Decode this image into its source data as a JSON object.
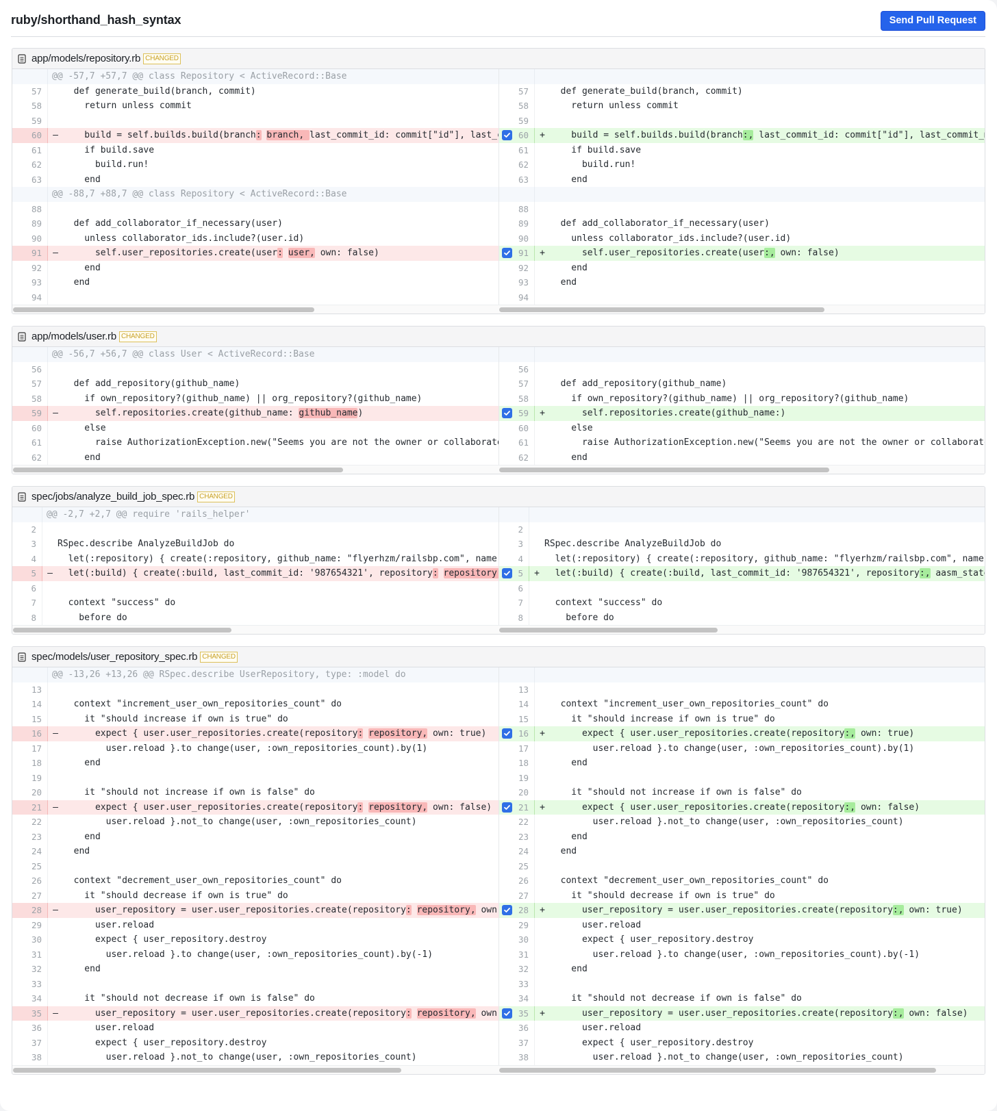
{
  "header": {
    "title": "ruby/shorthand_hash_syntax",
    "send_button_label": "Send Pull Request",
    "accent_color": "#2563eb"
  },
  "badge_label": "CHANGED",
  "files": [
    {
      "path": "app/models/repository.rb",
      "status": "CHANGED",
      "narrow": false,
      "scroll": {
        "left_visible_fraction": 0.62,
        "right_visible_fraction": 0.67
      },
      "rows": [
        {
          "type": "hunk",
          "text": "@@ -57,7 +57,7 @@ class Repository < ActiveRecord::Base"
        },
        {
          "type": "ctx",
          "ln": 57,
          "rn": 57,
          "left": "  def generate_build(branch, commit)",
          "right": "  def generate_build(branch, commit)"
        },
        {
          "type": "ctx",
          "ln": 58,
          "rn": 58,
          "left": "    return unless commit",
          "right": "    return unless commit"
        },
        {
          "type": "ctx",
          "ln": 59,
          "rn": 59,
          "left": "",
          "right": ""
        },
        {
          "type": "change",
          "ln": 60,
          "rn": 60,
          "checked": true,
          "left": [
            [
              "    build = self.builds.build(branch",
              ""
            ],
            [
              ":",
              "del"
            ],
            [
              " ",
              ""
            ],
            [
              "branch, ",
              "del"
            ],
            [
              "last_commit_id: commit[\"id\"], last_commit_message: commit[\"message\"])",
              ""
            ]
          ],
          "right": [
            [
              "    build = self.builds.build(branch",
              ""
            ],
            [
              ":,",
              "add"
            ],
            [
              " last_commit_id: commit[\"id\"], last_commit_message: commit[\"message\"])",
              ""
            ]
          ]
        },
        {
          "type": "ctx",
          "ln": 61,
          "rn": 61,
          "left": "    if build.save",
          "right": "    if build.save"
        },
        {
          "type": "ctx",
          "ln": 62,
          "rn": 62,
          "left": "      build.run!",
          "right": "      build.run!"
        },
        {
          "type": "ctx",
          "ln": 63,
          "rn": 63,
          "left": "    end",
          "right": "    end"
        },
        {
          "type": "hunk",
          "text": "@@ -88,7 +88,7 @@ class Repository < ActiveRecord::Base"
        },
        {
          "type": "ctx",
          "ln": 88,
          "rn": 88,
          "left": "",
          "right": ""
        },
        {
          "type": "ctx",
          "ln": 89,
          "rn": 89,
          "left": "  def add_collaborator_if_necessary(user)",
          "right": "  def add_collaborator_if_necessary(user)"
        },
        {
          "type": "ctx",
          "ln": 90,
          "rn": 90,
          "left": "    unless collaborator_ids.include?(user.id)",
          "right": "    unless collaborator_ids.include?(user.id)"
        },
        {
          "type": "change",
          "ln": 91,
          "rn": 91,
          "checked": true,
          "left": [
            [
              "      self.user_repositories.create(user",
              ""
            ],
            [
              ":",
              "del"
            ],
            [
              " ",
              ""
            ],
            [
              "user,",
              "del"
            ],
            [
              " own: false)",
              ""
            ]
          ],
          "right": [
            [
              "      self.user_repositories.create(user",
              ""
            ],
            [
              ":,",
              "add"
            ],
            [
              " own: false)",
              ""
            ]
          ]
        },
        {
          "type": "ctx",
          "ln": 92,
          "rn": 92,
          "left": "    end",
          "right": "    end"
        },
        {
          "type": "ctx",
          "ln": 93,
          "rn": 93,
          "left": "  end",
          "right": "  end"
        },
        {
          "type": "ctx",
          "ln": 94,
          "rn": 94,
          "left": "",
          "right": ""
        }
      ]
    },
    {
      "path": "app/models/user.rb",
      "status": "CHANGED",
      "narrow": false,
      "scroll": {
        "left_visible_fraction": 0.68,
        "right_visible_fraction": 0.68
      },
      "rows": [
        {
          "type": "hunk",
          "text": "@@ -56,7 +56,7 @@ class User < ActiveRecord::Base"
        },
        {
          "type": "ctx",
          "ln": 56,
          "rn": 56,
          "left": "",
          "right": ""
        },
        {
          "type": "ctx",
          "ln": 57,
          "rn": 57,
          "left": "  def add_repository(github_name)",
          "right": "  def add_repository(github_name)"
        },
        {
          "type": "ctx",
          "ln": 58,
          "rn": 58,
          "left": "    if own_repository?(github_name) || org_repository?(github_name)",
          "right": "    if own_repository?(github_name) || org_repository?(github_name)"
        },
        {
          "type": "change",
          "ln": 59,
          "rn": 59,
          "checked": true,
          "left": [
            [
              "      self.repositories.create(github_name: ",
              ""
            ],
            [
              "github_name",
              "del"
            ],
            [
              ")",
              ""
            ]
          ],
          "right": [
            [
              "      self.repositories.create(github_name:)",
              ""
            ]
          ]
        },
        {
          "type": "ctx",
          "ln": 60,
          "rn": 60,
          "left": "    else",
          "right": "    else"
        },
        {
          "type": "ctx",
          "ln": 61,
          "rn": 61,
          "left": "      raise AuthorizationException.new(\"Seems you are not the owner or collaborator of this repository\")",
          "right": "      raise AuthorizationException.new(\"Seems you are not the owner or collaborator of this repository\")"
        },
        {
          "type": "ctx",
          "ln": 62,
          "rn": 62,
          "left": "    end",
          "right": "    end"
        }
      ]
    },
    {
      "path": "spec/jobs/analyze_build_job_spec.rb",
      "status": "CHANGED",
      "narrow": true,
      "scroll": {
        "left_visible_fraction": 0.45,
        "right_visible_fraction": 0.45
      },
      "rows": [
        {
          "type": "hunk",
          "text": "@@ -2,7 +2,7 @@ require 'rails_helper'"
        },
        {
          "type": "ctx",
          "ln": 2,
          "rn": 2,
          "left": "",
          "right": ""
        },
        {
          "type": "ctx",
          "ln": 3,
          "rn": 3,
          "left": "RSpec.describe AnalyzeBuildJob do",
          "right": "RSpec.describe AnalyzeBuildJob do"
        },
        {
          "type": "ctx",
          "ln": 4,
          "rn": 4,
          "left": "  let(:repository) { create(:repository, github_name: \"flyerhzm/railsbp.com\", name: \"railsbp.com\") }",
          "right": "  let(:repository) { create(:repository, github_name: \"flyerhzm/railsbp.com\", name: \"railsbp.com\") }"
        },
        {
          "type": "change",
          "ln": 5,
          "rn": 5,
          "checked": true,
          "left": [
            [
              "  let(:build) { create(:build, last_commit_id: '987654321', repository",
              ""
            ],
            [
              ":",
              "del"
            ],
            [
              " ",
              ""
            ],
            [
              "repository,",
              "del"
            ],
            [
              " aasm_state: 'running') }",
              ""
            ]
          ],
          "right": [
            [
              "  let(:build) { create(:build, last_commit_id: '987654321', repository",
              ""
            ],
            [
              ":,",
              "add"
            ],
            [
              " aasm_state: 'running') }",
              ""
            ]
          ]
        },
        {
          "type": "ctx",
          "ln": 6,
          "rn": 6,
          "left": "",
          "right": ""
        },
        {
          "type": "ctx",
          "ln": 7,
          "rn": 7,
          "left": "  context \"success\" do",
          "right": "  context \"success\" do"
        },
        {
          "type": "ctx",
          "ln": 8,
          "rn": 8,
          "left": "    before do",
          "right": "    before do"
        }
      ]
    },
    {
      "path": "spec/models/user_repository_spec.rb",
      "status": "CHANGED",
      "narrow": false,
      "scroll": {
        "left_visible_fraction": 0.8,
        "right_visible_fraction": 0.9
      },
      "rows": [
        {
          "type": "hunk",
          "text": "@@ -13,26 +13,26 @@ RSpec.describe UserRepository, type: :model do"
        },
        {
          "type": "ctx",
          "ln": 13,
          "rn": 13,
          "left": "",
          "right": ""
        },
        {
          "type": "ctx",
          "ln": 14,
          "rn": 14,
          "left": "  context \"increment_user_own_repositories_count\" do",
          "right": "  context \"increment_user_own_repositories_count\" do"
        },
        {
          "type": "ctx",
          "ln": 15,
          "rn": 15,
          "left": "    it \"should increase if own is true\" do",
          "right": "    it \"should increase if own is true\" do"
        },
        {
          "type": "change",
          "ln": 16,
          "rn": 16,
          "checked": true,
          "left": [
            [
              "      expect { user.user_repositories.create(repository",
              ""
            ],
            [
              ":",
              "del"
            ],
            [
              " ",
              ""
            ],
            [
              "repository,",
              "del"
            ],
            [
              " own: true)",
              ""
            ]
          ],
          "right": [
            [
              "      expect { user.user_repositories.create(repository",
              ""
            ],
            [
              ":,",
              "add"
            ],
            [
              " own: true)",
              ""
            ]
          ]
        },
        {
          "type": "ctx",
          "ln": 17,
          "rn": 17,
          "left": "        user.reload }.to change(user, :own_repositories_count).by(1)",
          "right": "        user.reload }.to change(user, :own_repositories_count).by(1)"
        },
        {
          "type": "ctx",
          "ln": 18,
          "rn": 18,
          "left": "    end",
          "right": "    end"
        },
        {
          "type": "ctx",
          "ln": 19,
          "rn": 19,
          "left": "",
          "right": ""
        },
        {
          "type": "ctx",
          "ln": 20,
          "rn": 20,
          "left": "    it \"should not increase if own is false\" do",
          "right": "    it \"should not increase if own is false\" do"
        },
        {
          "type": "change",
          "ln": 21,
          "rn": 21,
          "checked": true,
          "left": [
            [
              "      expect { user.user_repositories.create(repository",
              ""
            ],
            [
              ":",
              "del"
            ],
            [
              " ",
              ""
            ],
            [
              "repository,",
              "del"
            ],
            [
              " own: false)",
              ""
            ]
          ],
          "right": [
            [
              "      expect { user.user_repositories.create(repository",
              ""
            ],
            [
              ":,",
              "add"
            ],
            [
              " own: false)",
              ""
            ]
          ]
        },
        {
          "type": "ctx",
          "ln": 22,
          "rn": 22,
          "left": "        user.reload }.not_to change(user, :own_repositories_count)",
          "right": "        user.reload }.not_to change(user, :own_repositories_count)"
        },
        {
          "type": "ctx",
          "ln": 23,
          "rn": 23,
          "left": "    end",
          "right": "    end"
        },
        {
          "type": "ctx",
          "ln": 24,
          "rn": 24,
          "left": "  end",
          "right": "  end"
        },
        {
          "type": "ctx",
          "ln": 25,
          "rn": 25,
          "left": "",
          "right": ""
        },
        {
          "type": "ctx",
          "ln": 26,
          "rn": 26,
          "left": "  context \"decrement_user_own_repositories_count\" do",
          "right": "  context \"decrement_user_own_repositories_count\" do"
        },
        {
          "type": "ctx",
          "ln": 27,
          "rn": 27,
          "left": "    it \"should decrease if own is true\" do",
          "right": "    it \"should decrease if own is true\" do"
        },
        {
          "type": "change",
          "ln": 28,
          "rn": 28,
          "checked": true,
          "left": [
            [
              "      user_repository = user.user_repositories.create(repository",
              ""
            ],
            [
              ":",
              "del"
            ],
            [
              " ",
              ""
            ],
            [
              "repository,",
              "del"
            ],
            [
              " own: true)",
              ""
            ]
          ],
          "right": [
            [
              "      user_repository = user.user_repositories.create(repository",
              ""
            ],
            [
              ":,",
              "add"
            ],
            [
              " own: true)",
              ""
            ]
          ]
        },
        {
          "type": "ctx",
          "ln": 29,
          "rn": 29,
          "left": "      user.reload",
          "right": "      user.reload"
        },
        {
          "type": "ctx",
          "ln": 30,
          "rn": 30,
          "left": "      expect { user_repository.destroy",
          "right": "      expect { user_repository.destroy"
        },
        {
          "type": "ctx",
          "ln": 31,
          "rn": 31,
          "left": "        user.reload }.to change(user, :own_repositories_count).by(-1)",
          "right": "        user.reload }.to change(user, :own_repositories_count).by(-1)"
        },
        {
          "type": "ctx",
          "ln": 32,
          "rn": 32,
          "left": "    end",
          "right": "    end"
        },
        {
          "type": "ctx",
          "ln": 33,
          "rn": 33,
          "left": "",
          "right": ""
        },
        {
          "type": "ctx",
          "ln": 34,
          "rn": 34,
          "left": "    it \"should not decrease if own is false\" do",
          "right": "    it \"should not decrease if own is false\" do"
        },
        {
          "type": "change",
          "ln": 35,
          "rn": 35,
          "checked": true,
          "left": [
            [
              "      user_repository = user.user_repositories.create(repository",
              ""
            ],
            [
              ":",
              "del"
            ],
            [
              " ",
              ""
            ],
            [
              "repository,",
              "del"
            ],
            [
              " own: false)",
              ""
            ]
          ],
          "right": [
            [
              "      user_repository = user.user_repositories.create(repository",
              ""
            ],
            [
              ":,",
              "add"
            ],
            [
              " own: false)",
              ""
            ]
          ]
        },
        {
          "type": "ctx",
          "ln": 36,
          "rn": 36,
          "left": "      user.reload",
          "right": "      user.reload"
        },
        {
          "type": "ctx",
          "ln": 37,
          "rn": 37,
          "left": "      expect { user_repository.destroy",
          "right": "      expect { user_repository.destroy"
        },
        {
          "type": "ctx",
          "ln": 38,
          "rn": 38,
          "left": "        user.reload }.not_to change(user, :own_repositories_count)",
          "right": "        user.reload }.not_to change(user, :own_repositories_count)"
        }
      ]
    }
  ]
}
